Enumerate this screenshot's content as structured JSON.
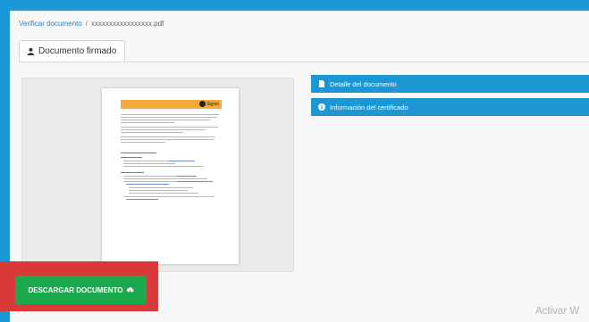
{
  "breadcrumb": {
    "root": "Verificar documento",
    "separator": "/",
    "file": "xxxxxxxxxxxxxxxxx.pdf"
  },
  "tab": {
    "label": "Documento firmado",
    "icon": "user-icon"
  },
  "preview": {
    "logo_text": "Signio",
    "logo_icon": "signature-logo-icon"
  },
  "actions": [
    {
      "label": "Detalle del documento",
      "icon": "file-icon"
    },
    {
      "label": "Información del certificado",
      "icon": "info-icon"
    }
  ],
  "download": {
    "label": "DESCARGAR DOCUMENTO",
    "icon": "cloud-download-icon"
  },
  "watermark": "Activar W",
  "colors": {
    "background": "#1a99d6",
    "action_button": "#1d96d4",
    "download_button": "#1aa94c",
    "highlight": "#d83a3a",
    "document_banner": "#f3a93b"
  }
}
